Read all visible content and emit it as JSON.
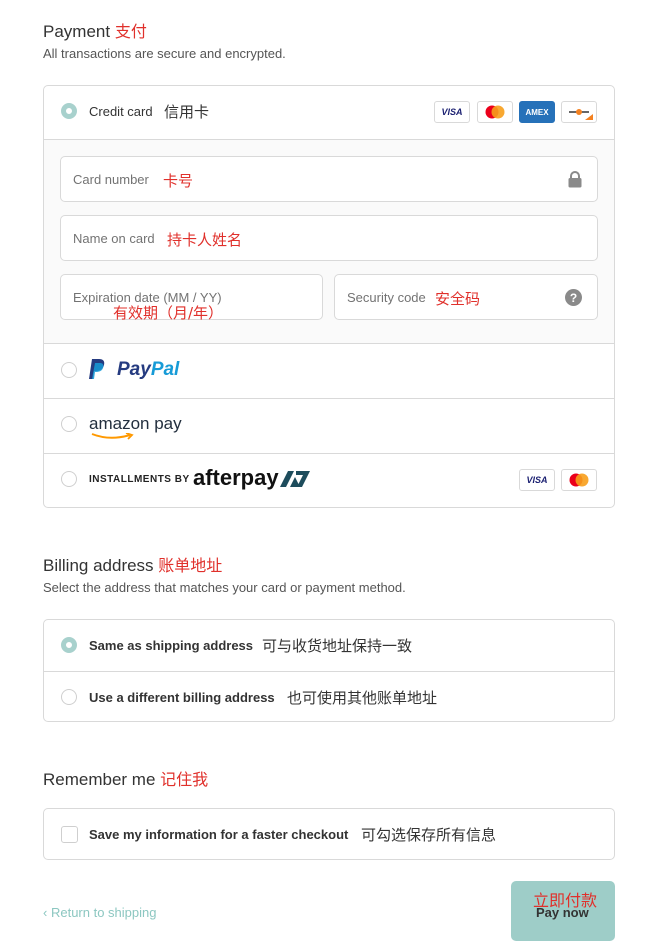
{
  "payment": {
    "title": "Payment",
    "title_note": "支付",
    "subtitle": "All transactions are secure and encrypted.",
    "credit_card": {
      "label": "Credit card",
      "note": "信用卡",
      "brands": [
        "VISA",
        "Mastercard",
        "AMEX",
        "Discover"
      ]
    },
    "card_number": {
      "placeholder": "Card number",
      "note": "卡号"
    },
    "name_on_card": {
      "placeholder": "Name on card",
      "note": "持卡人姓名"
    },
    "expiration": {
      "placeholder": "Expiration date (MM / YY)",
      "note": "有效期（月/年）"
    },
    "security_code": {
      "placeholder": "Security code",
      "note": "安全码"
    },
    "paypal": {
      "label": "PayPal"
    },
    "amazon": {
      "label": "amazon pay"
    },
    "afterpay": {
      "prefix": "INSTALLMENTS BY",
      "brand": "afterpay",
      "brands": [
        "VISA",
        "Mastercard"
      ]
    }
  },
  "billing": {
    "title": "Billing address",
    "title_note": "账单地址",
    "subtitle": "Select the address that matches your card or payment method.",
    "same": {
      "label": "Same as shipping address",
      "note": "可与收货地址保持一致"
    },
    "different": {
      "label": "Use a different billing address",
      "note": "也可使用其他账单地址"
    }
  },
  "remember": {
    "title": "Remember me",
    "title_note": "记住我",
    "checkbox_label": "Save my information for a faster checkout",
    "checkbox_note": "可勾选保存所有信息"
  },
  "footer": {
    "return_link": "Return to shipping",
    "pay_note": "立即付款",
    "pay_button": "Pay now"
  },
  "colors": {
    "accent": "#a8d1cd",
    "annotation": "#e0302b",
    "button_bg": "#9ecdc8"
  }
}
